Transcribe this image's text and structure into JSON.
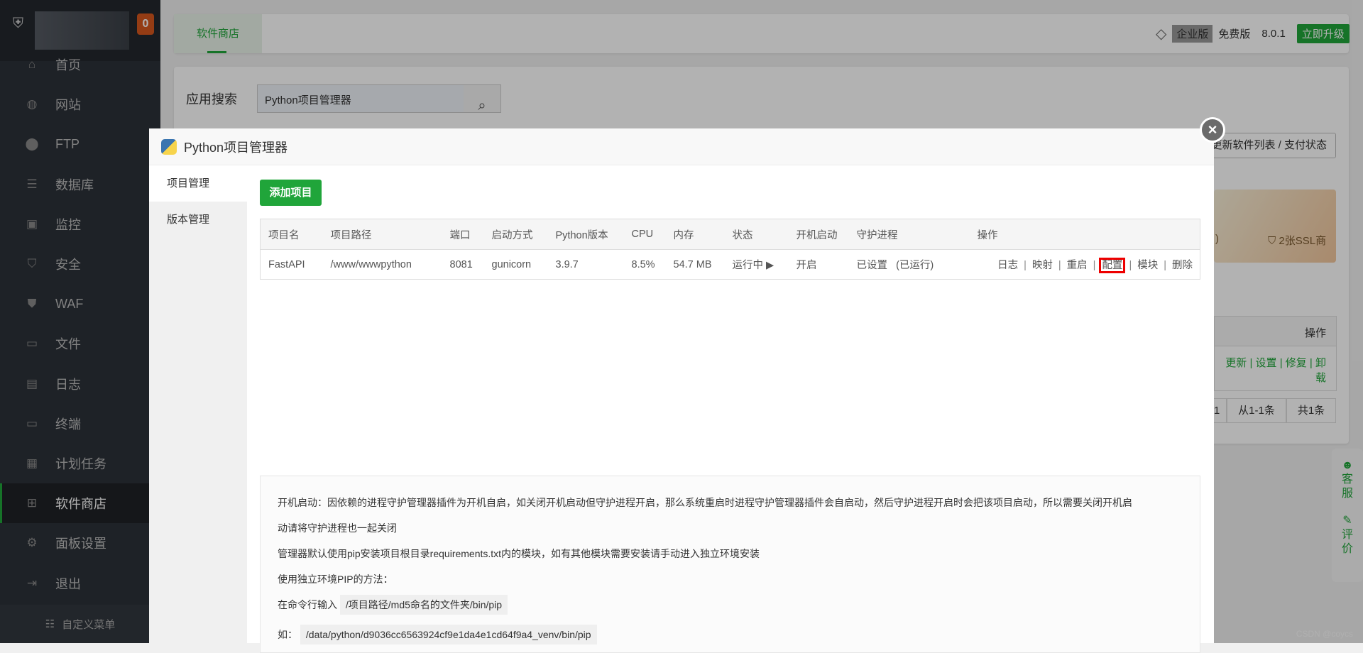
{
  "sidebar": {
    "badge": "0",
    "items": [
      {
        "label": "首页",
        "icon": "home-icon"
      },
      {
        "label": "网站",
        "icon": "globe-icon"
      },
      {
        "label": "FTP",
        "icon": "ftp-icon"
      },
      {
        "label": "数据库",
        "icon": "database-icon"
      },
      {
        "label": "监控",
        "icon": "monitor-icon"
      },
      {
        "label": "安全",
        "icon": "shield-icon"
      },
      {
        "label": "WAF",
        "icon": "waf-icon"
      },
      {
        "label": "文件",
        "icon": "folder-icon"
      },
      {
        "label": "日志",
        "icon": "log-icon"
      },
      {
        "label": "终端",
        "icon": "terminal-icon"
      },
      {
        "label": "计划任务",
        "icon": "calendar-icon"
      },
      {
        "label": "软件商店",
        "icon": "grid-icon",
        "active": true
      },
      {
        "label": "面板设置",
        "icon": "gear-icon"
      },
      {
        "label": "退出",
        "icon": "logout-icon"
      }
    ],
    "custom_menu": "自定义菜单"
  },
  "header": {
    "tab": "软件商店",
    "enterprise": "企业版",
    "free": "免费版",
    "version": "8.0.1",
    "upgrade": "立即升级"
  },
  "search": {
    "label": "应用搜索",
    "value": "Python项目管理器"
  },
  "background": {
    "update_btn": "更新软件列表 / 支付状态",
    "ssl": "2张SSL商",
    "col_ops": "操作",
    "row_ops": "更新 | 设置 | 修复 | 卸载",
    "pager": [
      "1",
      "从1-1条",
      "共1条"
    ],
    "paren": ")"
  },
  "float": {
    "service": "客服",
    "review": "评价"
  },
  "watermark": "CSDN @coycs",
  "modal": {
    "title": "Python项目管理器",
    "nav": [
      "项目管理",
      "版本管理"
    ],
    "add": "添加项目",
    "columns": [
      "项目名",
      "项目路径",
      "端口",
      "启动方式",
      "Python版本",
      "CPU",
      "内存",
      "状态",
      "开机启动",
      "守护进程",
      "操作"
    ],
    "rows": [
      {
        "name": "FastAPI",
        "path": "/www/wwwpython",
        "port": "8081",
        "mode": "gunicorn",
        "py": "3.9.7",
        "cpu": "8.5%",
        "mem": "54.7 MB",
        "status": "运行中 ▶",
        "boot": "开启",
        "daemon": "已设置",
        "daemon_state": "(已运行)",
        "actions": [
          "日志",
          "映射",
          "重启",
          "配置",
          "模块",
          "删除"
        ]
      }
    ],
    "notes": {
      "l1": "开机启动：因依赖的进程守护管理器插件为开机自启，如关闭开机启动但守护进程开启，那么系统重启时进程守护管理器插件会自启动，然后守护进程开启时会把该项目启动，所以需要关闭开机启",
      "l2": "动请将守护进程也一起关闭",
      "l3": "管理器默认使用pip安装项目根目录requirements.txt内的模块，如有其他模块需要安装请手动进入独立环境安装",
      "l4": "使用独立环境PIP的方法：",
      "l5": "在命令行输入",
      "l5c": "/项目路径/md5命名的文件夹/bin/pip",
      "l6": "如：",
      "l6c": "/data/python/d9036cc6563924cf9e1da4e1cd64f9a4_venv/bin/pip"
    }
  },
  "colors": {
    "accent": "#20a53a",
    "badge": "#d4561e",
    "highlight": "#e00000"
  }
}
